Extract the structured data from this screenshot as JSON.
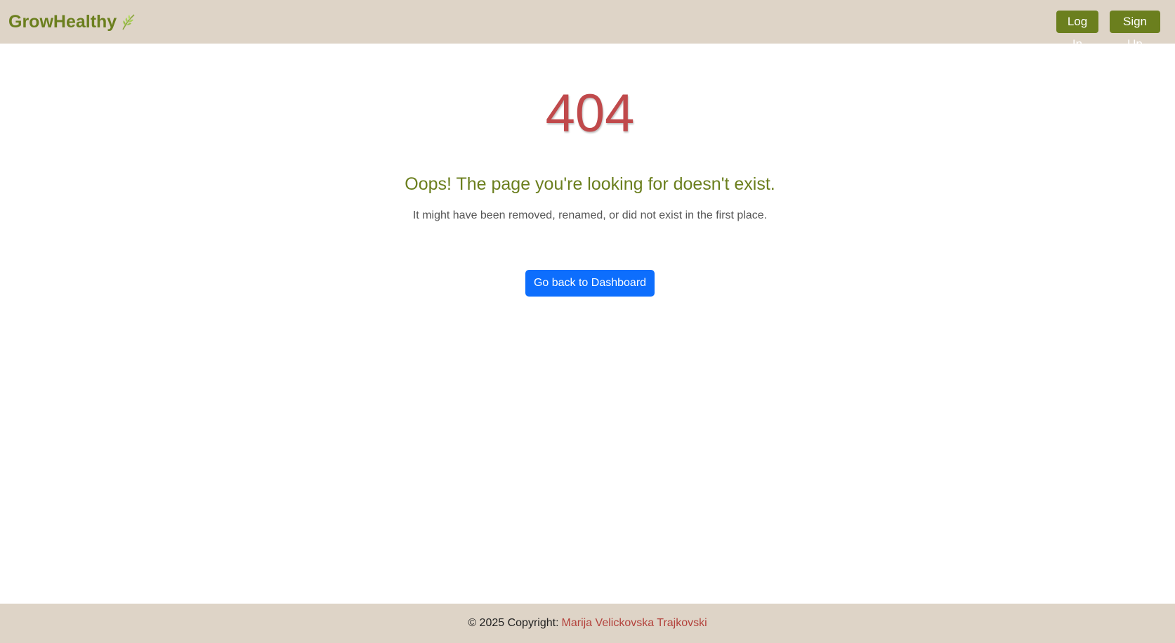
{
  "navbar": {
    "brand": "GrowHealthy",
    "brand_icon": "leaf-icon",
    "login_label": "Log In",
    "signup_label": "Sign Up"
  },
  "main": {
    "code": "404",
    "title": "Oops! The page you're looking for doesn't exist.",
    "subtitle": "It might have been removed, renamed, or did not exist in the first place.",
    "button_label": "Go back to Dashboard"
  },
  "footer": {
    "prefix": "© 2025 Copyright:",
    "author": "Marija Velickovska Trajkovski"
  },
  "colors": {
    "navbar_bg": "#ded4c7",
    "brand": "#6b7f1e",
    "error_code": "#c0494b",
    "primary_button": "#0d6efd",
    "footer_link": "#b3413b"
  }
}
